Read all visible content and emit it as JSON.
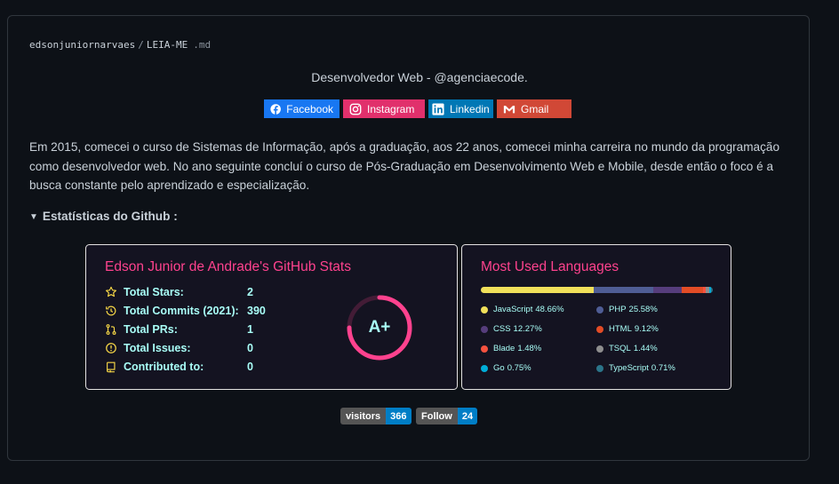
{
  "breadcrumb": {
    "owner": "edsonjuniornarvaes",
    "separator": "/",
    "file": "LEIA-ME",
    "ext": ".md"
  },
  "tagline": "Desenvolvedor Web - @agenciaecode.",
  "badges": [
    {
      "label": "Facebook",
      "color": "#1877f2",
      "icon": "facebook-icon"
    },
    {
      "label": "Instagram",
      "color": "#e1306c",
      "icon": "instagram-icon"
    },
    {
      "label": "Linkedin",
      "color": "#0077b5",
      "icon": "linkedin-icon"
    },
    {
      "label": "Gmail",
      "color": "#d14836",
      "icon": "gmail-icon"
    }
  ],
  "paragraph": "Em 2015, comecei o curso de Sistemas de Informação, após a graduação, aos 22 anos, comecei minha carreira no mundo da programação como desenvolvedor web. No ano seguinte concluí o curso de Pós-Graduação em Desenvolvimento Web e Mobile, desde então o foco é a busca constante pelo aprendizado e especialização.",
  "details": {
    "summary": "Estatísticas do Github :",
    "marker": "▼"
  },
  "stats_card": {
    "title": "Edson Junior de Andrade's GitHub Stats",
    "grade": "A+",
    "rows": [
      {
        "label": "Total Stars:",
        "value": "2",
        "icon": "star-icon"
      },
      {
        "label": "Total Commits (2021):",
        "value": "390",
        "icon": "history-icon"
      },
      {
        "label": "Total PRs:",
        "value": "1",
        "icon": "pull-request-icon"
      },
      {
        "label": "Total Issues:",
        "value": "0",
        "icon": "issue-icon"
      },
      {
        "label": "Contributed to:",
        "value": "0",
        "icon": "repo-icon"
      }
    ],
    "colors": {
      "title": "#fe428e",
      "text": "#a9fef7",
      "icon": "#f8d847",
      "ring": "#fe428e",
      "background": "#141321"
    }
  },
  "langs_card": {
    "title": "Most Used Languages",
    "languages": [
      {
        "name": "JavaScript",
        "pct": "48.66%",
        "value": 48.66,
        "color": "#f1e05a"
      },
      {
        "name": "PHP",
        "pct": "25.58%",
        "value": 25.58,
        "color": "#4f5d95"
      },
      {
        "name": "CSS",
        "pct": "12.27%",
        "value": 12.27,
        "color": "#563d7c"
      },
      {
        "name": "HTML",
        "pct": "9.12%",
        "value": 9.12,
        "color": "#e34c26"
      },
      {
        "name": "Blade",
        "pct": "1.48%",
        "value": 1.48,
        "color": "#f7523f"
      },
      {
        "name": "TSQL",
        "pct": "1.44%",
        "value": 1.44,
        "color": "#8e8e8e"
      },
      {
        "name": "Go",
        "pct": "0.75%",
        "value": 0.75,
        "color": "#00add8"
      },
      {
        "name": "TypeScript",
        "pct": "0.71%",
        "value": 0.71,
        "color": "#2b7489"
      }
    ]
  },
  "counters": [
    {
      "label": "visitors",
      "value": "366"
    },
    {
      "label": "Follow",
      "value": "24"
    }
  ]
}
